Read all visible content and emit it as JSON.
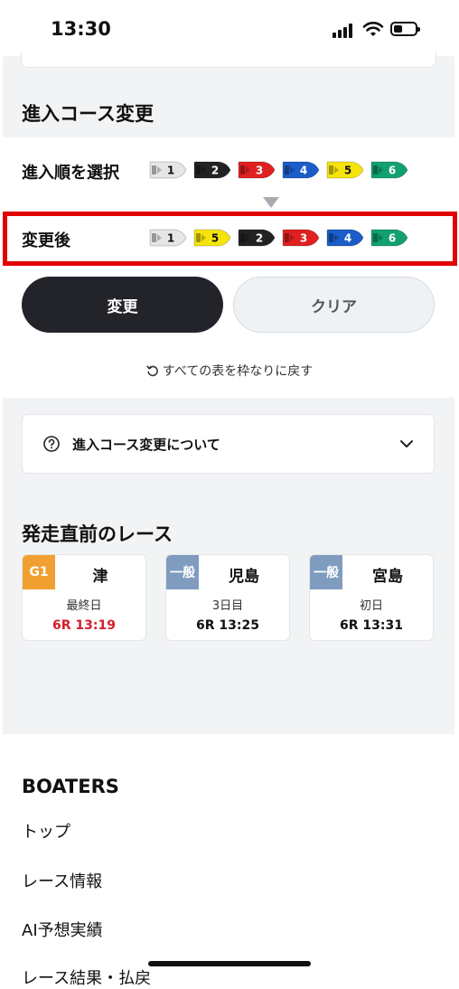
{
  "status": {
    "time": "13:30"
  },
  "section": {
    "title": "進入コース変更"
  },
  "select_row": {
    "label": "進入順を選択",
    "boats": [
      {
        "num": "1",
        "color": "#e6e6e6",
        "text_color": "#111111"
      },
      {
        "num": "2",
        "color": "#222222",
        "text_color": "#ffffff"
      },
      {
        "num": "3",
        "color": "#e02020",
        "text_color": "#ffffff"
      },
      {
        "num": "4",
        "color": "#1a5dc8",
        "text_color": "#ffffff"
      },
      {
        "num": "5",
        "color": "#f5e40c",
        "text_color": "#111111"
      },
      {
        "num": "6",
        "color": "#12a06e",
        "text_color": "#ffffff"
      }
    ]
  },
  "after_row": {
    "label": "変更後",
    "boats": [
      {
        "num": "1",
        "color": "#e6e6e6",
        "text_color": "#111111"
      },
      {
        "num": "5",
        "color": "#f5e40c",
        "text_color": "#111111"
      },
      {
        "num": "2",
        "color": "#222222",
        "text_color": "#ffffff"
      },
      {
        "num": "3",
        "color": "#e02020",
        "text_color": "#ffffff"
      },
      {
        "num": "4",
        "color": "#1a5dc8",
        "text_color": "#ffffff"
      },
      {
        "num": "6",
        "color": "#12a06e",
        "text_color": "#ffffff"
      }
    ]
  },
  "buttons": {
    "change_label": "変更",
    "clear_label": "クリア"
  },
  "reset": {
    "label": "すべての表を枠なりに戻す"
  },
  "faq": {
    "label": "進入コース変更について"
  },
  "races": {
    "title": "発走直前のレース",
    "cards": [
      {
        "badge": "G1",
        "badge_color": "#f0a030",
        "venue": "津",
        "day": "最終日",
        "time": "6R 13:19",
        "time_color": "#d0202a"
      },
      {
        "badge": "一般",
        "badge_color": "#7f9cc0",
        "venue": "児島",
        "day": "3日目",
        "time": "6R 13:25",
        "time_color": "#111111"
      },
      {
        "badge": "一般",
        "badge_color": "#7f9cc0",
        "venue": "宮島",
        "day": "初日",
        "time": "6R 13:31",
        "time_color": "#111111"
      }
    ]
  },
  "footer": {
    "brand": "BOATERS",
    "links": [
      "トップ",
      "レース情報",
      "AI予想実績",
      "レース結果・払戻"
    ]
  },
  "colors": {
    "highlight": "#e30000",
    "primary_button": "#23242a"
  }
}
